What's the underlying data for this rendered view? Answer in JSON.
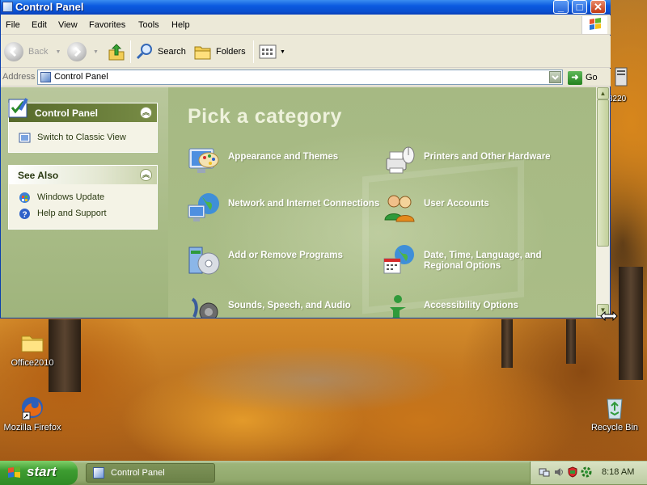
{
  "window": {
    "title": "Control Panel",
    "min_label": "_",
    "max_label": "□",
    "close_label": "✕"
  },
  "menu": [
    "File",
    "Edit",
    "View",
    "Favorites",
    "Tools",
    "Help"
  ],
  "toolbar": {
    "back_label": "Back",
    "search_label": "Search",
    "folders_label": "Folders"
  },
  "address": {
    "label": "Address",
    "value": "Control Panel",
    "go_label": "Go"
  },
  "sidebar": {
    "control_panel": {
      "title": "Control Panel",
      "items": [
        "Switch to Classic View"
      ]
    },
    "see_also": {
      "title": "See Also",
      "items": [
        "Windows Update",
        "Help and Support"
      ]
    }
  },
  "main": {
    "heading": "Pick a category",
    "categories": [
      "Appearance and Themes",
      "Printers and Other Hardware",
      "Network and Internet Connections",
      "User Accounts",
      "Add or Remove Programs",
      "Date, Time, Language, and Regional Options",
      "Sounds, Speech, and Audio",
      "Accessibility Options"
    ]
  },
  "desktop": {
    "icons": [
      "Office2010",
      "Mozilla Firefox",
      "Recycle Bin",
      "3220"
    ]
  },
  "taskbar": {
    "start_label": "start",
    "task_label": "Control Panel",
    "clock": "8:18 AM"
  }
}
